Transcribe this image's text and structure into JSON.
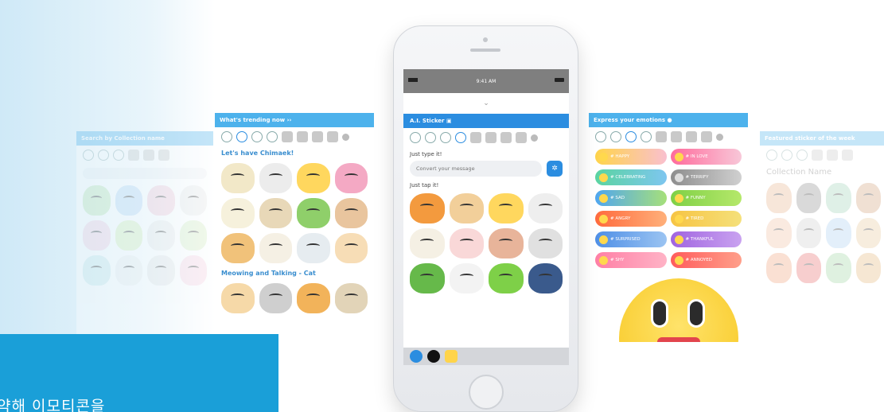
{
  "screen_trending": {
    "header": "What's trending now",
    "section1": "Let's have Chimaek!",
    "section2": "Meowing and Talking - Cat"
  },
  "screen_ai": {
    "header": "A.I. Sticker",
    "type_label": "Just type it!",
    "input_placeholder": "Convert your message",
    "tap_label": "Just tap it!",
    "status_time": "9:41 AM"
  },
  "screen_emotions": {
    "header": "Express your emotions",
    "tags": [
      [
        "# HAPPY",
        "# IN LOVE"
      ],
      [
        "# CELEBRATING",
        "# TERRIFY"
      ],
      [
        "# SAD",
        "# FUNNY"
      ],
      [
        "# ANGRY",
        "# TIRED"
      ],
      [
        "# SURPRISED",
        "# THANKFUL"
      ],
      [
        "# SHY",
        "# ANNOYED"
      ]
    ]
  },
  "screen_search": {
    "header": "Search by Collection name",
    "placeholder": "Search by Collection name"
  },
  "screen_featured": {
    "header": "Featured sticker of the week",
    "collection_name": "Collection Name"
  },
  "bottom_text": "약해 이모티콘을",
  "colors": {
    "accent_blue": "#2b8de0",
    "header_blue": "#4db2ec",
    "block_blue": "#1a9fd8"
  }
}
